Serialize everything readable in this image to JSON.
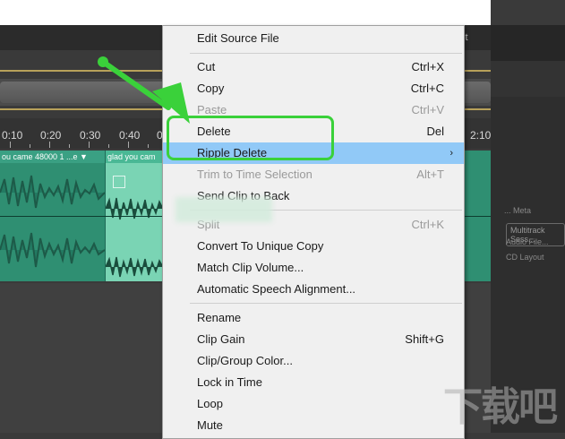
{
  "topbar": {
    "right_label": "lt"
  },
  "ruler": {
    "ticks": [
      "0:10",
      "0:20",
      "0:30",
      "0:40",
      "0",
      "2:10"
    ]
  },
  "clips": {
    "clip1_title": "ou came 48000 1 ...e ▼",
    "clip2_title": "glad you cam"
  },
  "right_panel": {
    "items": [
      "Multitrack Sess...",
      "Audio File...",
      "CD Layout",
      "... Meta"
    ]
  },
  "menu": {
    "edit_source": "Edit Source File",
    "cut": "Cut",
    "cut_sc": "Ctrl+X",
    "copy": "Copy",
    "copy_sc": "Ctrl+C",
    "paste": "Paste",
    "paste_sc": "Ctrl+V",
    "delete": "Delete",
    "delete_sc": "Del",
    "ripple_delete": "Ripple Delete",
    "ripple_arrow": "›",
    "trim": "Trim to Time Selection",
    "trim_sc": "Alt+T",
    "send_back": "Send Clip to Back",
    "split": "Split",
    "split_sc": "Ctrl+K",
    "convert": "Convert To Unique Copy",
    "match_volume": "Match Clip Volume...",
    "speech_align": "Automatic Speech Alignment...",
    "rename": "Rename",
    "clip_gain": "Clip Gain",
    "clip_gain_sc": "Shift+G",
    "clip_color": "Clip/Group Color...",
    "lock_time": "Lock in Time",
    "loop": "Loop",
    "mute": "Mute"
  },
  "watermark": {
    "text": "下载吧"
  },
  "colors": {
    "highlight": "#91c9f7",
    "annotation": "#3ad13a",
    "clip": "#2f8f72"
  }
}
